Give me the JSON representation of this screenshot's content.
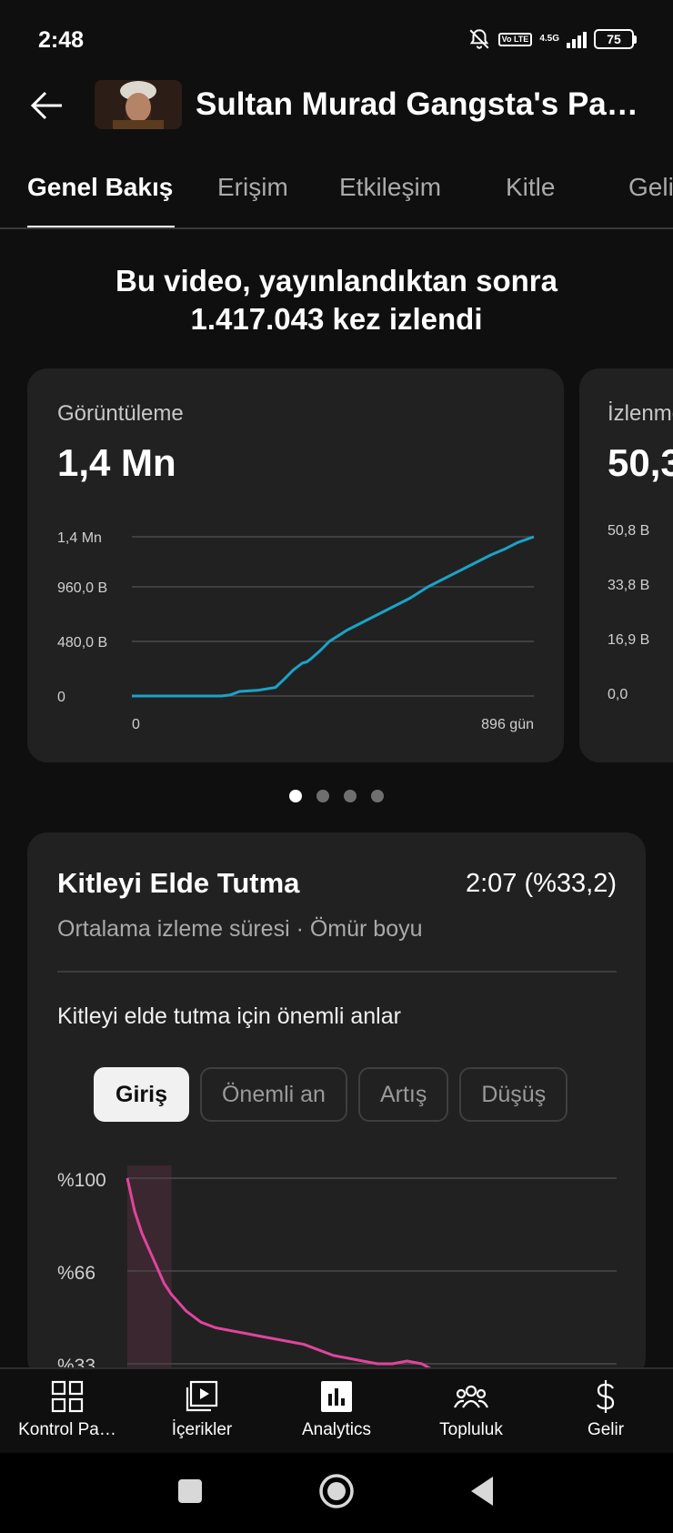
{
  "status": {
    "time": "2:48",
    "volte": "Vo LTE",
    "network": "4.5G",
    "battery": "75"
  },
  "header": {
    "title": "Sultan Murad Gangsta's Par…"
  },
  "tabs": [
    {
      "label": "Genel Bakış",
      "active": true
    },
    {
      "label": "Erişim",
      "active": false
    },
    {
      "label": "Etkileşim",
      "active": false
    },
    {
      "label": "Kitle",
      "active": false
    },
    {
      "label": "Geli",
      "active": false
    }
  ],
  "headline": {
    "line1": "Bu video, yayınlandıktan sonra",
    "line2": "1.417.043 kez izlendi"
  },
  "metric_cards": [
    {
      "label": "Görüntüleme",
      "value": "1,4 Mn",
      "y_ticks": [
        "1,4 Mn",
        "960,0 B",
        "480,0 B",
        "0"
      ],
      "x_ticks": [
        "0",
        "896 gün"
      ]
    },
    {
      "label": "İzlenme",
      "value": "50,3",
      "y_ticks": [
        "50,8 B",
        "33,8 B",
        "16,9 B",
        "0,0"
      ]
    }
  ],
  "carousel": {
    "pages": 4,
    "active_index": 0
  },
  "retention": {
    "title": "Kitleyi Elde Tutma",
    "value": "2:07 (%33,2)",
    "subtitle": "Ortalama izleme süresi · Ömür boyu",
    "moments_heading": "Kitleyi elde tutma için önemli anlar",
    "chips": [
      {
        "label": "Giriş",
        "active": true
      },
      {
        "label": "Önemli an",
        "active": false
      },
      {
        "label": "Artış",
        "active": false
      },
      {
        "label": "Düşüş",
        "active": false
      }
    ],
    "y_ticks": [
      "%100",
      "%66",
      "%33"
    ]
  },
  "bottom_nav": [
    {
      "label": "Kontrol Pa…",
      "icon": "dashboard-icon"
    },
    {
      "label": "İçerikler",
      "icon": "content-icon"
    },
    {
      "label": "Analytics",
      "icon": "analytics-icon"
    },
    {
      "label": "Topluluk",
      "icon": "community-icon"
    },
    {
      "label": "Gelir",
      "icon": "earn-icon"
    }
  ],
  "colors": {
    "background": "#0f0f0f",
    "card": "#212121",
    "views_line": "#1aa3c7",
    "retention_line": "#e0459c",
    "intro_highlight": "#3b2730"
  },
  "chart_data": [
    {
      "type": "line",
      "title": "Görüntüleme",
      "xlabel": "",
      "ylabel": "",
      "x_unit": "gün",
      "xlim": [
        0,
        896
      ],
      "ylim": [
        0,
        1400000
      ],
      "y_ticks": [
        0,
        480000,
        960000,
        1400000
      ],
      "grid": true,
      "series": [
        {
          "values_x": [
            0,
            100,
            200,
            220,
            240,
            280,
            320,
            340,
            360,
            380,
            390,
            400,
            420,
            440,
            460,
            480,
            500,
            540,
            580,
            620,
            660,
            700,
            740,
            780,
            800,
            830,
            860,
            896
          ],
          "values_y": [
            0,
            0,
            0,
            10000,
            40000,
            50000,
            75000,
            150000,
            230000,
            290000,
            300000,
            330000,
            400000,
            480000,
            530000,
            580000,
            620000,
            700000,
            780000,
            860000,
            960000,
            1040000,
            1120000,
            1200000,
            1240000,
            1290000,
            1350000,
            1400000
          ]
        }
      ]
    },
    {
      "type": "area",
      "title": "Kitleyi Elde Tutma",
      "y_unit": "%",
      "ylim": [
        0,
        100
      ],
      "y_ticks": [
        33,
        66,
        100
      ],
      "grid": true,
      "series": [
        {
          "values_x": [
            0,
            1,
            2,
            3,
            4,
            5,
            6,
            7,
            8,
            9,
            10,
            12,
            14,
            16,
            18,
            20,
            22,
            24,
            26,
            28,
            30,
            32,
            34,
            36,
            38,
            40,
            42
          ],
          "values_y": [
            100,
            88,
            80,
            74,
            68,
            62,
            58,
            55,
            52,
            50,
            48,
            46,
            45,
            44,
            43,
            42,
            41,
            40,
            38,
            36,
            35,
            34,
            33,
            33,
            34,
            33,
            30
          ]
        }
      ],
      "highlight_range": [
        0,
        6
      ]
    }
  ]
}
